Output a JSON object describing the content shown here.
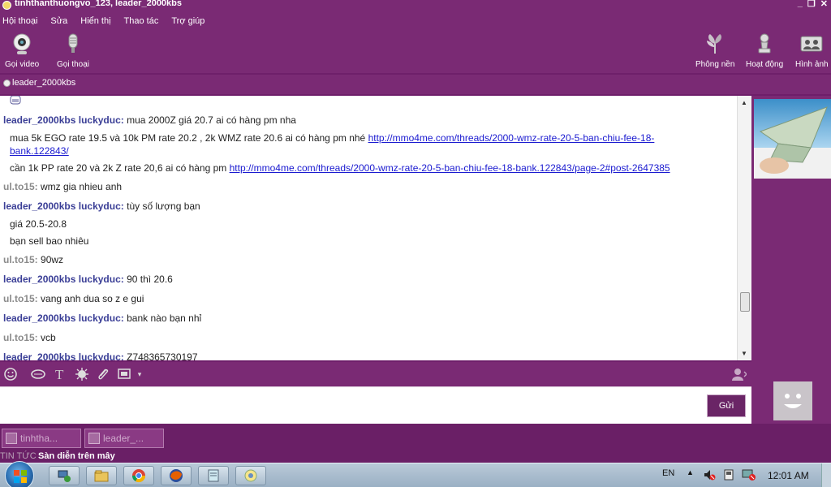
{
  "window": {
    "title": "tinhthanthuongvo_123, leader_2000kbs",
    "controls": [
      "_",
      "❐",
      "✕"
    ]
  },
  "menu": {
    "items": [
      "Hội thoại",
      "Sửa",
      "Hiển thị",
      "Thao tác",
      "Trợ giúp"
    ]
  },
  "toolbar": {
    "video_call": "Gọi video",
    "voice_call": "Gọi thoại",
    "background": "Phông nền",
    "activities": "Hoạt động",
    "photos": "Hình ảnh"
  },
  "contact": {
    "name": "leader_2000kbs"
  },
  "messages": [
    {
      "sender": "leader_2000kbs luckyduc:",
      "text": "mua 2000Z giá 20.7 ai có hàng pm nha"
    },
    {
      "cont1_text": "mua 5k EGO rate 19.5 và 10k PM rate 20.2 , 2k WMZ rate 20.6 ai có hàng pm nhé ",
      "cont1_link_a": "http://mmo4me.com/threads/2000-wmz-rate-20-5-ban-chiu-fee-18-",
      "cont1_link_b": "bank.122843/"
    },
    {
      "cont2_text": "cần 1k PP rate 20 và 2k Z rate 20,6 ai có hàng pm ",
      "cont2_link": "http://mmo4me.com/threads/2000-wmz-rate-20-5-ban-chiu-fee-18-bank.122843/page-2#post-2647385"
    },
    {
      "sender": "ul.to15:",
      "text": "wmz gia nhieu anh"
    },
    {
      "sender": "leader_2000kbs luckyduc:",
      "text": "tùy số lượng bạn"
    },
    {
      "cont": "giá 20.5-20.8"
    },
    {
      "cont": "bạn sell bao nhiêu"
    },
    {
      "sender": "ul.to15:",
      "text": "90wz"
    },
    {
      "sender": "leader_2000kbs luckyduc:",
      "text": "90 thì 20.6"
    },
    {
      "sender": "ul.to15:",
      "text": "vang anh dua so z e gui"
    },
    {
      "sender": "leader_2000kbs luckyduc:",
      "text": "bank nào bạn nhỉ"
    },
    {
      "sender": "ul.to15:",
      "text": "vcb"
    },
    {
      "sender": "leader_2000kbs luckyduc:",
      "text": "Z748365730197"
    }
  ],
  "compose": {
    "send_label": "Gửi"
  },
  "tabs": [
    {
      "label": "tinhtha..."
    },
    {
      "label": "leader_..."
    }
  ],
  "news": {
    "label": "TIN TỨC",
    "headline": "Sàn diễn trên mây"
  },
  "taskbar": {
    "language": "EN",
    "time": "12:01 AM"
  },
  "colors": {
    "theme_purple": "#7a2a74",
    "sender_a": "#3a3e96",
    "sender_b": "#8a8a8a",
    "link": "#1a1ad0"
  }
}
